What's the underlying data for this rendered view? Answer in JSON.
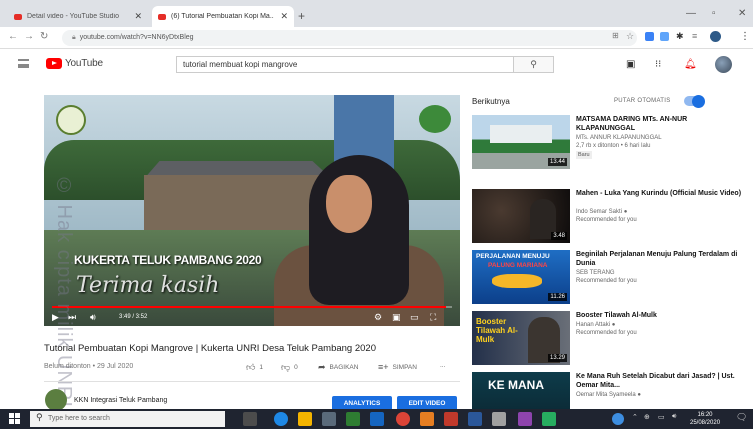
{
  "browser": {
    "tabs": [
      {
        "label": "Detail video - YouTube Studio",
        "active": false
      },
      {
        "label": "(6) Tutorial Pembuatan Kopi Ma...",
        "active": true
      }
    ],
    "url": "youtube.com/watch?v=NN6yDtxBleg",
    "window_controls": [
      "—",
      "▫",
      "✕"
    ]
  },
  "youtube": {
    "logo_text": "YouTube",
    "search_query": "tutorial membuat kopi mangrove"
  },
  "player": {
    "overlay_title": "KUKERTA TELUK PAMBANG 2020",
    "overlay_script": "Terima kasih",
    "watermark": "© Hak cipta milik UNRI",
    "timecode": "3:49 / 3:52",
    "progress": 0.985
  },
  "video": {
    "title": "Tutorial Pembuatan Kopi Mangrove | Kukerta UNRI Desa Teluk Pambang 2020",
    "date": "Belum ditonton • 29 Jul 2020",
    "likes": "1",
    "dislikes": "0",
    "share_label": "BAGIKAN",
    "save_label": "SIMPAN",
    "more_label": "...",
    "channel": "KKN Integrasi Teluk Pambang",
    "analytics_label": "ANALYTICS",
    "edit_label": "EDIT VIDEO"
  },
  "sidebar": {
    "next_label": "Berikutnya",
    "autoplay_label": "PUTAR OTOMATIS",
    "autoplay_on": true,
    "items": [
      {
        "title": "MATSAMA DARING MTs. AN-NUR KLAPANUNGGAL",
        "channel": "MTs. ANNUR KLAPANUNGGAL",
        "meta": "2,7 rb x ditonton • 6 hari lalu",
        "badge": "Baru",
        "duration": "13.44"
      },
      {
        "title": "Mahen - Luka Yang Kurindu (Official Music Video)",
        "channel": "Indo Semar Sakti ●",
        "meta": "Recommended for you",
        "badge": "",
        "duration": "3.48"
      },
      {
        "title": "Beginilah Perjalanan Menuju Palung Terdalam di Dunia",
        "channel": "SEB TERANG",
        "meta": "Recommended for you",
        "badge": "",
        "duration": "11.26"
      },
      {
        "title": "Booster Tilawah Al-Mulk",
        "channel": "Hanan Attaki ●",
        "meta": "Recommended for you",
        "badge": "",
        "duration": "13.29"
      },
      {
        "title": "Ke Mana Ruh Setelah Dicabut dari Jasad? | Ust. Oemar Mita...",
        "channel": "Oemar Mita Syameela ●",
        "meta": "Recommended for you",
        "badge": "",
        "duration": ""
      }
    ],
    "thumb_texts": {
      "perjalanan": "PERJALANAN MENUJU",
      "palung": "PALUNG MARIANA",
      "booster": "Booster Tilawah Al-Mulk",
      "kemana": "KE MANA"
    }
  },
  "taskbar": {
    "search_placeholder": "Type here to search",
    "time": "16:20",
    "date": "25/08/2020"
  }
}
